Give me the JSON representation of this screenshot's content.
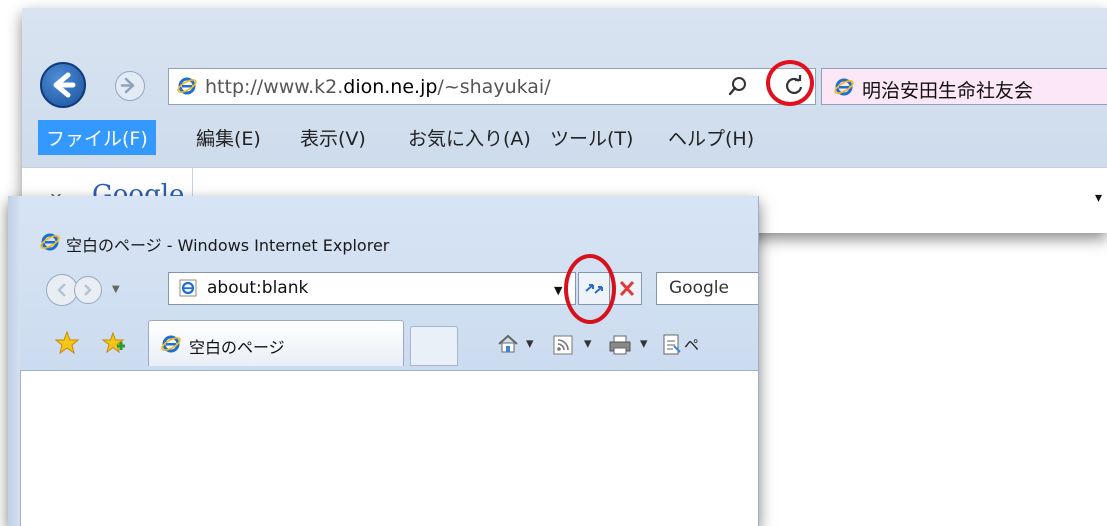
{
  "top": {
    "url_prefix": "http://www.k2.",
    "url_domain": "dion.ne.jp",
    "url_suffix": "/~shayukai/",
    "tab_title": "明治安田生命社友会",
    "menu": [
      "ファイル(F)",
      "編集(E)",
      "表示(V)",
      "お気に入り(A)",
      "ツール(T)",
      "ヘルプ(H)"
    ],
    "google_close": "x",
    "google_logo": "Google",
    "dropdown_arrow": "▾"
  },
  "bottom": {
    "window_title": "空白のページ - Windows Internet Explorer",
    "address": "about:blank",
    "search_provider": "Google",
    "tab_title": "空白のページ",
    "command_partial": "ペ"
  },
  "colors": {
    "highlight_circle": "#e0101e",
    "menu_active": "#3399ff",
    "ie_blue": "#1e6fd0"
  }
}
